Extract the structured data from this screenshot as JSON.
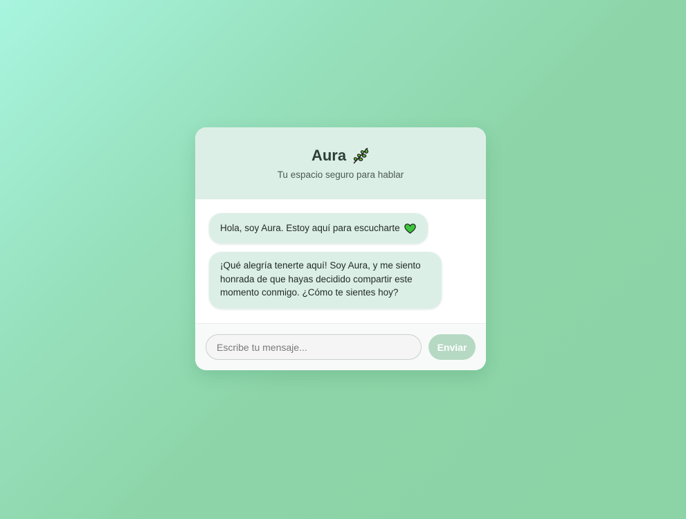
{
  "header": {
    "title": "Aura",
    "title_icon": "herb-leaf-icon",
    "subtitle": "Tu espacio seguro para hablar"
  },
  "messages": [
    {
      "sender": "Aura",
      "text": "Hola, soy Aura. Estoy aquí para escucharte",
      "trailing_icon": "green-heart-icon"
    },
    {
      "sender": "Aura",
      "text": "¡Qué alegría tenerte aquí! Soy Aura, y me siento honrada de que hayas decidido compartir este momento conmigo. ¿Cómo te sientes hoy?"
    }
  ],
  "composer": {
    "placeholder": "Escribe tu mensaje...",
    "value": "",
    "send_label": "Enviar"
  },
  "colors": {
    "header_bg": "#dcefe6",
    "bubble_bg": "#dcefe6",
    "send_button_bg": "#b6d9c3",
    "heart": "#3cc63c",
    "leaf": "#5fb83a"
  }
}
